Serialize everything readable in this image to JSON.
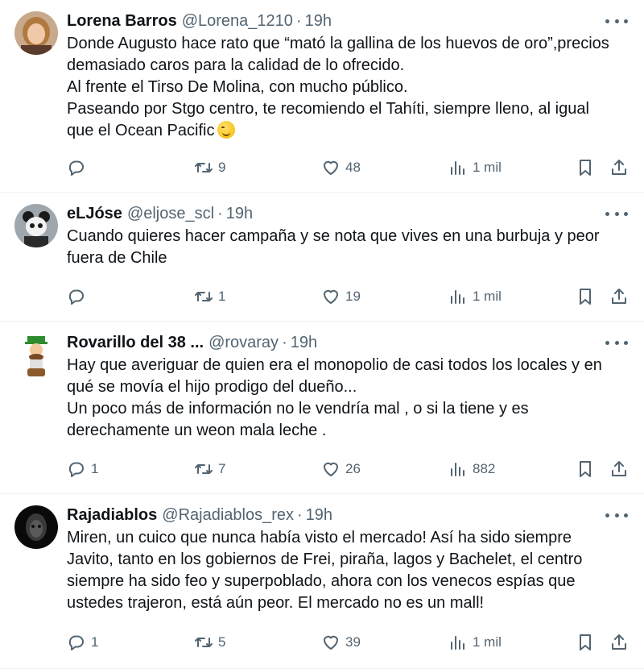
{
  "tweets": [
    {
      "name": "Lorena Barros",
      "handle": "@Lorena_1210",
      "time": "19h",
      "text": "Donde Augusto hace rato que “mató la gallina de los huevos de oro”,precios\ndemasiado caros para la calidad de lo ofrecido.\nAl frente el Tirso De Molina, con mucho público.\nPaseando por Stgo centro, te recomiendo el Tahíti, siempre lleno, al igual\nque el Ocean Pacific",
      "replies": "",
      "retweets": "9",
      "likes": "48",
      "views": "1 mil"
    },
    {
      "name": "eLJóse",
      "handle": "@eljose_scl",
      "time": "19h",
      "text": "Cuando quieres hacer campaña y se nota que vives en una burbuja y peor\nfuera de Chile",
      "replies": "",
      "retweets": "1",
      "likes": "19",
      "views": "1 mil"
    },
    {
      "name": "Rovarillo del 38 ...",
      "handle": "@rovaray",
      "time": "19h",
      "text": "Hay que averiguar de quien era el monopolio de casi todos los locales  y en\nqué se movía el hijo prodigo del dueño...\nUn poco más de información no le vendría mal , o si la tiene y es\nderechamente un weon mala leche .",
      "replies": "1",
      "retweets": "7",
      "likes": "26",
      "views": "882"
    },
    {
      "name": "Rajadiablos",
      "handle": "@Rajadiablos_rex",
      "time": "19h",
      "text": "Miren, un cuico que nunca había visto el mercado! Así ha sido siempre\nJavito, tanto en los gobiernos de Frei, piraña, lagos y Bachelet, el centro\nsiempre ha sido feo y superpoblado, ahora con los venecos espías que\nustedes trajeron, está aún peor. El mercado no es un mall!",
      "replies": "1",
      "retweets": "5",
      "likes": "39",
      "views": "1 mil"
    }
  ],
  "separator": "·",
  "colors": {
    "text": "#0f1419",
    "secondary": "#536471",
    "border": "#eff3f4"
  }
}
